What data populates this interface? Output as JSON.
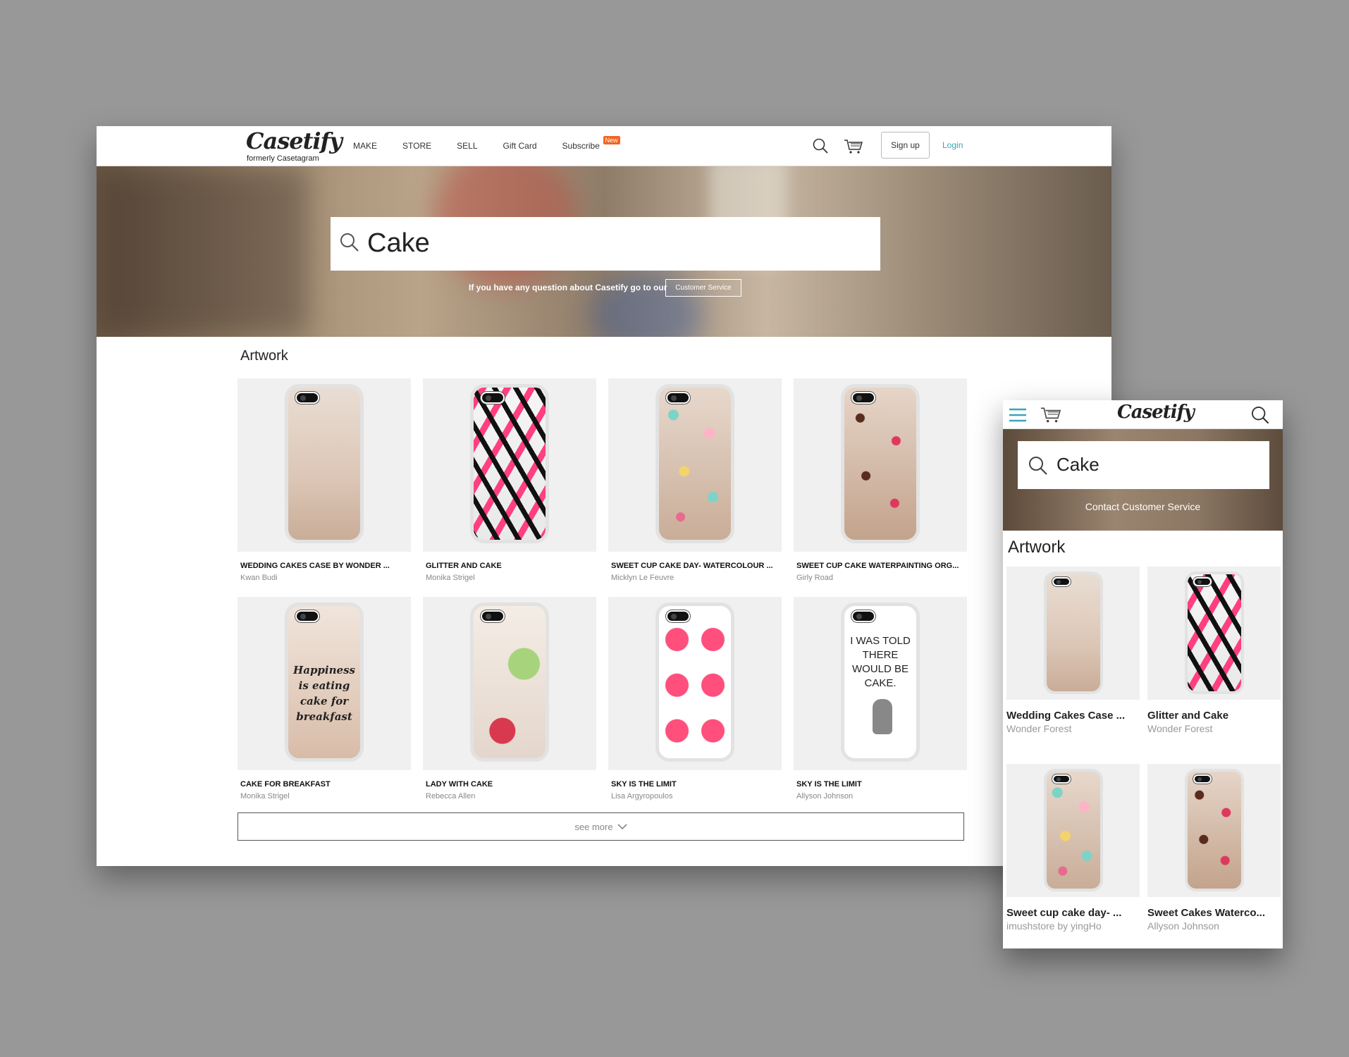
{
  "desktop": {
    "nav": {
      "logo": "Casetify",
      "sublogo": "formerly Casetagram",
      "links": [
        "MAKE",
        "STORE",
        "SELL",
        "Gift Card",
        "Subscribe"
      ],
      "new_badge": "New",
      "signup": "Sign up",
      "login": "Login"
    },
    "hero": {
      "search_value": "Cake",
      "note": "If you have any question about Casetify go to our",
      "service_button": "Customer Service"
    },
    "section_title": "Artwork",
    "products": [
      {
        "title": "WEDDING CAKES CASE BY WONDER ...",
        "author": "Kwan Budi",
        "pattern": "clear"
      },
      {
        "title": "GLITTER AND CAKE",
        "author": "Monika Strigel",
        "pattern": "triangles"
      },
      {
        "title": "SWEET CUP CAKE DAY- WATERCOLOUR ...",
        "author": "Micklyn Le Feuvre",
        "pattern": "cupcakes"
      },
      {
        "title": "SWEET CUP CAKE WATERPAINTING ORG...",
        "author": "Girly Road",
        "pattern": "cupcakes2"
      },
      {
        "title": "CAKE FOR BREAKFAST",
        "author": "Monika Strigel",
        "pattern": "gold"
      },
      {
        "title": "LADY WITH CAKE",
        "author": "Rebecca Allen",
        "pattern": "lady"
      },
      {
        "title": "SKY IS THE LIMIT",
        "author": "Lisa Argyropoulos",
        "pattern": "muffins"
      },
      {
        "title": "SKY IS THE LIMIT",
        "author": "Allyson Johnson",
        "pattern": "white"
      }
    ],
    "case_text": {
      "happiness": "Happiness is eating cake for breakfast",
      "told": "I WAS TOLD THERE WOULD BE CAKE."
    },
    "see_more": "see more"
  },
  "mobile": {
    "logo": "Casetify",
    "search_value": "Cake",
    "hero_note": "Contact Customer Service",
    "section_title": "Artwork",
    "products": [
      {
        "title": "Wedding Cakes Case ...",
        "author": "Wonder Forest"
      },
      {
        "title": "Glitter and Cake",
        "author": "Wonder Forest"
      },
      {
        "title": "Sweet cup cake day- ...",
        "author": "imushstore by yingHo"
      },
      {
        "title": "Sweet Cakes Waterco...",
        "author": "Allyson Johnson"
      }
    ]
  },
  "colors": {
    "accent": "#3aa6b6",
    "badge": "#f26522",
    "background": "#989898"
  },
  "icons": [
    "search-icon",
    "cart-icon",
    "menu-icon",
    "chevron-down-icon"
  ]
}
